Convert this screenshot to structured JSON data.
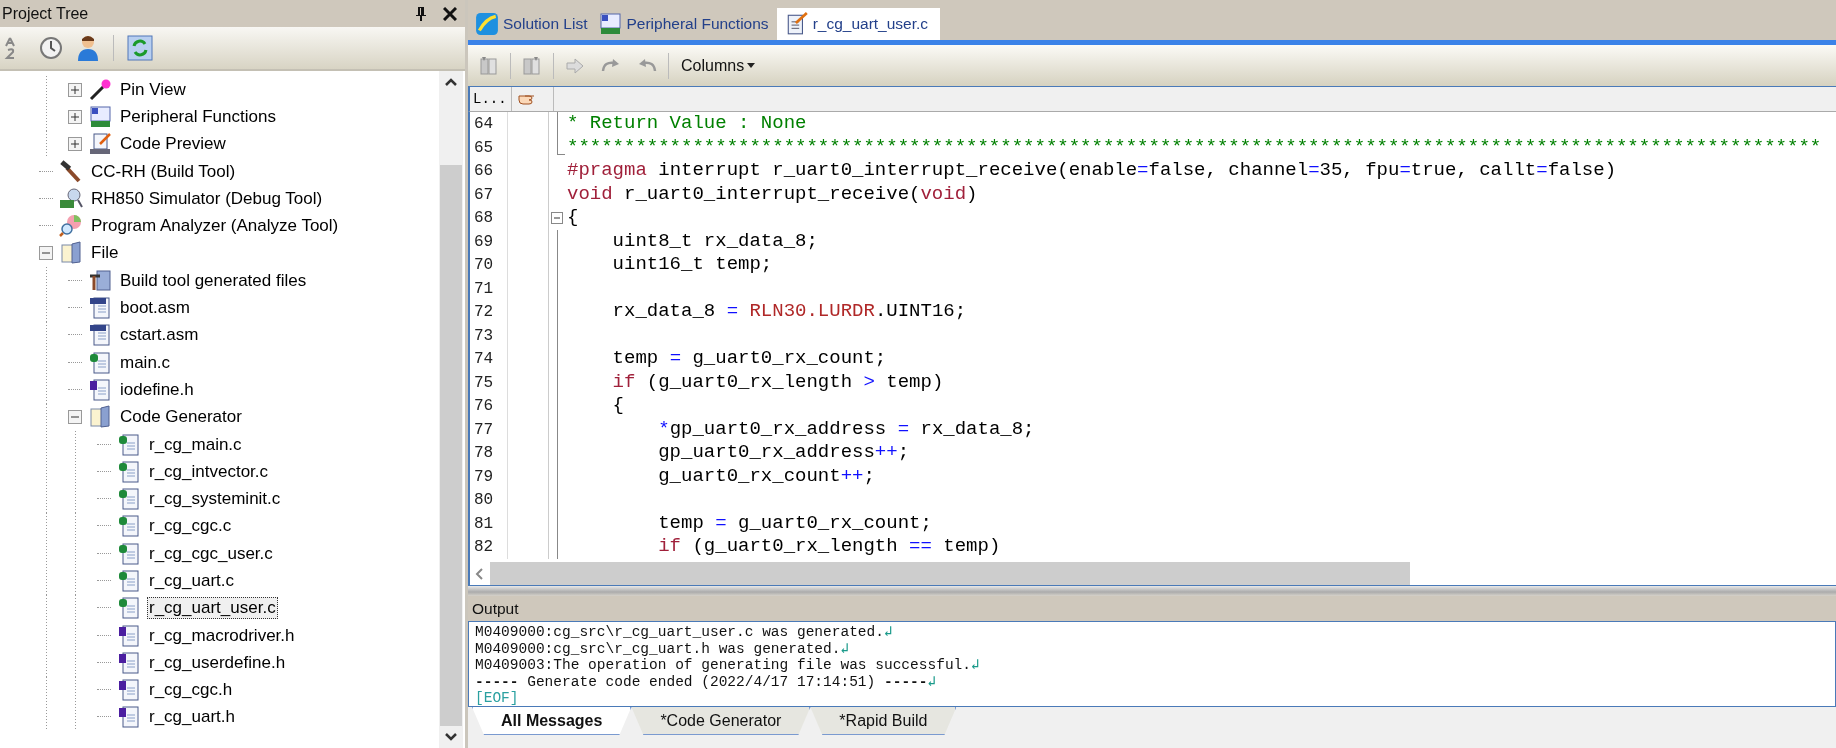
{
  "project_tree": {
    "title": "Project Tree",
    "continued_children": [
      {
        "label": "Pin View",
        "kind": "pin",
        "expanded": false,
        "selected": false
      },
      {
        "label": "Peripheral Functions",
        "kind": "peripheral",
        "expanded": false,
        "selected": false
      },
      {
        "label": "Code Preview",
        "kind": "preview",
        "expanded": false,
        "selected": false
      }
    ],
    "items": [
      {
        "label": "CC-RH (Build Tool)",
        "kind": "build-tool",
        "selected": false
      },
      {
        "label": "RH850 Simulator (Debug Tool)",
        "kind": "debug-tool",
        "selected": false
      },
      {
        "label": "Program Analyzer (Analyze Tool)",
        "kind": "analyzer",
        "selected": false
      },
      {
        "label": "File",
        "kind": "folder",
        "expanded": true,
        "selected": false,
        "children": [
          {
            "label": "Build tool generated files",
            "kind": "build-files",
            "selected": false
          },
          {
            "label": "boot.asm",
            "kind": "asm",
            "selected": false
          },
          {
            "label": "cstart.asm",
            "kind": "asm",
            "selected": false
          },
          {
            "label": "main.c",
            "kind": "c",
            "selected": false
          },
          {
            "label": "iodefine.h",
            "kind": "h",
            "selected": false
          },
          {
            "label": "Code Generator",
            "kind": "folder",
            "expanded": true,
            "selected": false,
            "children": [
              {
                "label": "r_cg_main.c",
                "kind": "c",
                "selected": false
              },
              {
                "label": "r_cg_intvector.c",
                "kind": "c",
                "selected": false
              },
              {
                "label": "r_cg_systeminit.c",
                "kind": "c",
                "selected": false
              },
              {
                "label": "r_cg_cgc.c",
                "kind": "c",
                "selected": false
              },
              {
                "label": "r_cg_cgc_user.c",
                "kind": "c",
                "selected": false
              },
              {
                "label": "r_cg_uart.c",
                "kind": "c",
                "selected": false
              },
              {
                "label": "r_cg_uart_user.c",
                "kind": "c",
                "selected": true
              },
              {
                "label": "r_cg_macrodriver.h",
                "kind": "h",
                "selected": false
              },
              {
                "label": "r_cg_userdefine.h",
                "kind": "h",
                "selected": false
              },
              {
                "label": "r_cg_cgc.h",
                "kind": "h",
                "selected": false
              },
              {
                "label": "r_cg_uart.h",
                "kind": "h",
                "selected": false
              }
            ]
          }
        ]
      }
    ]
  },
  "editor_tabs": [
    {
      "label": "Solution List",
      "kind": "solution",
      "selected": false
    },
    {
      "label": "Peripheral Functions",
      "kind": "peripheral",
      "selected": false
    },
    {
      "label": "r_cg_uart_user.c",
      "kind": "file",
      "selected": true
    }
  ],
  "editor_toolbar": {
    "buttons": [
      {
        "kind": "bookmark-prev",
        "disabled": true
      },
      {
        "kind": "bookmark-next",
        "disabled": true
      },
      {
        "kind": "forward",
        "disabled": true
      },
      {
        "kind": "redo",
        "disabled": true
      },
      {
        "kind": "undo",
        "disabled": true
      }
    ],
    "columns_menu": "Columns"
  },
  "editor": {
    "line_column_header": "L...",
    "lines": [
      {
        "number": "64",
        "kind": "guide",
        "tokens": [
          {
            "text": "* Return Value : None",
            "kind": "comment"
          }
        ]
      },
      {
        "number": "65",
        "kind": "guide-end",
        "tokens": [
          {
            "text": "**************************************************************************************************************",
            "kind": "comment"
          }
        ]
      },
      {
        "number": "66",
        "kind": "plain",
        "tokens": [
          {
            "text": "#pragma",
            "kind": "keyword"
          },
          {
            "text": " interrupt r_uart0_interrupt_receive(enable",
            "kind": "plain"
          },
          {
            "text": "=",
            "kind": "operator"
          },
          {
            "text": "false, channel",
            "kind": "plain"
          },
          {
            "text": "=",
            "kind": "operator"
          },
          {
            "text": "35, fpu",
            "kind": "plain"
          },
          {
            "text": "=",
            "kind": "operator"
          },
          {
            "text": "true, callt",
            "kind": "plain"
          },
          {
            "text": "=",
            "kind": "operator"
          },
          {
            "text": "false)",
            "kind": "plain"
          }
        ]
      },
      {
        "number": "67",
        "kind": "plain",
        "tokens": [
          {
            "text": "void",
            "kind": "keyword"
          },
          {
            "text": " r_uart0_interrupt_receive(",
            "kind": "plain"
          },
          {
            "text": "void",
            "kind": "keyword"
          },
          {
            "text": ")",
            "kind": "plain"
          }
        ]
      },
      {
        "number": "68",
        "kind": "collapse",
        "tokens": [
          {
            "text": "{",
            "kind": "plain"
          }
        ]
      },
      {
        "number": "69",
        "kind": "guide",
        "tokens": [
          {
            "text": "    uint8_t rx_data_8;",
            "kind": "plain"
          }
        ]
      },
      {
        "number": "70",
        "kind": "guide",
        "tokens": [
          {
            "text": "    uint16_t temp;",
            "kind": "plain"
          }
        ]
      },
      {
        "number": "71",
        "kind": "guide"
      },
      {
        "number": "72",
        "kind": "guide",
        "tokens": [
          {
            "text": "    rx_data_8 ",
            "kind": "plain"
          },
          {
            "text": "= ",
            "kind": "operator"
          },
          {
            "text": "RLN30.LURDR",
            "kind": "register"
          },
          {
            "text": ".UINT16;",
            "kind": "plain"
          }
        ]
      },
      {
        "number": "73",
        "kind": "guide"
      },
      {
        "number": "74",
        "kind": "guide",
        "tokens": [
          {
            "text": "    temp ",
            "kind": "plain"
          },
          {
            "text": "=",
            "kind": "operator"
          },
          {
            "text": " g_uart0_rx_count;",
            "kind": "plain"
          }
        ]
      },
      {
        "number": "75",
        "kind": "guide",
        "tokens": [
          {
            "text": "    if",
            "kind": "keyword"
          },
          {
            "text": " (g_uart0_rx_length ",
            "kind": "plain"
          },
          {
            "text": ">",
            "kind": "operator"
          },
          {
            "text": " temp)",
            "kind": "plain"
          }
        ]
      },
      {
        "number": "76",
        "kind": "guide",
        "tokens": [
          {
            "text": "    {",
            "kind": "plain"
          }
        ]
      },
      {
        "number": "77",
        "kind": "guide",
        "tokens": [
          {
            "text": "        *",
            "kind": "operator"
          },
          {
            "text": "gp_uart0_rx_address ",
            "kind": "plain"
          },
          {
            "text": "=",
            "kind": "operator"
          },
          {
            "text": " rx_data_8;",
            "kind": "plain"
          }
        ]
      },
      {
        "number": "78",
        "kind": "guide",
        "tokens": [
          {
            "text": "        gp_uart0_rx_address",
            "kind": "plain"
          },
          {
            "text": "++",
            "kind": "operator"
          },
          {
            "text": ";",
            "kind": "plain"
          }
        ]
      },
      {
        "number": "79",
        "kind": "guide",
        "tokens": [
          {
            "text": "        g_uart0_rx_count",
            "kind": "plain"
          },
          {
            "text": "++",
            "kind": "operator"
          },
          {
            "text": ";",
            "kind": "plain"
          }
        ]
      },
      {
        "number": "80",
        "kind": "guide"
      },
      {
        "number": "81",
        "kind": "guide",
        "tokens": [
          {
            "text": "        temp ",
            "kind": "plain"
          },
          {
            "text": "=",
            "kind": "operator"
          },
          {
            "text": " g_uart0_rx_count;",
            "kind": "plain"
          }
        ]
      },
      {
        "number": "82",
        "kind": "guide",
        "tokens": [
          {
            "text": "        if",
            "kind": "keyword"
          },
          {
            "text": " (g_uart0_rx_length ",
            "kind": "plain"
          },
          {
            "text": "==",
            "kind": "operator"
          },
          {
            "text": " temp)",
            "kind": "plain"
          }
        ]
      }
    ]
  },
  "output": {
    "title": "Output",
    "lines": [
      {
        "kind": "message",
        "text": "M0409000:cg_src\\r_cg_uart_user.c was generated.",
        "end_mark": "↲"
      },
      {
        "kind": "message",
        "text": "M0409000:cg_src\\r_cg_uart.h was generated.",
        "end_mark": "↲"
      },
      {
        "kind": "message",
        "text": "M0409003:The operation of generating file was successful.",
        "end_mark": "↲"
      },
      {
        "kind": "message",
        "text": "**-----** Generate code ended (2022/4/17 17:14:51) **-----**",
        "end_mark": "↲"
      },
      {
        "kind": "eof",
        "text": "[EOF]"
      }
    ],
    "tabs": [
      {
        "label": "All Messages",
        "selected": true
      },
      {
        "label": "*Code Generator",
        "selected": false
      },
      {
        "label": "*Rapid Build",
        "selected": false
      }
    ]
  }
}
